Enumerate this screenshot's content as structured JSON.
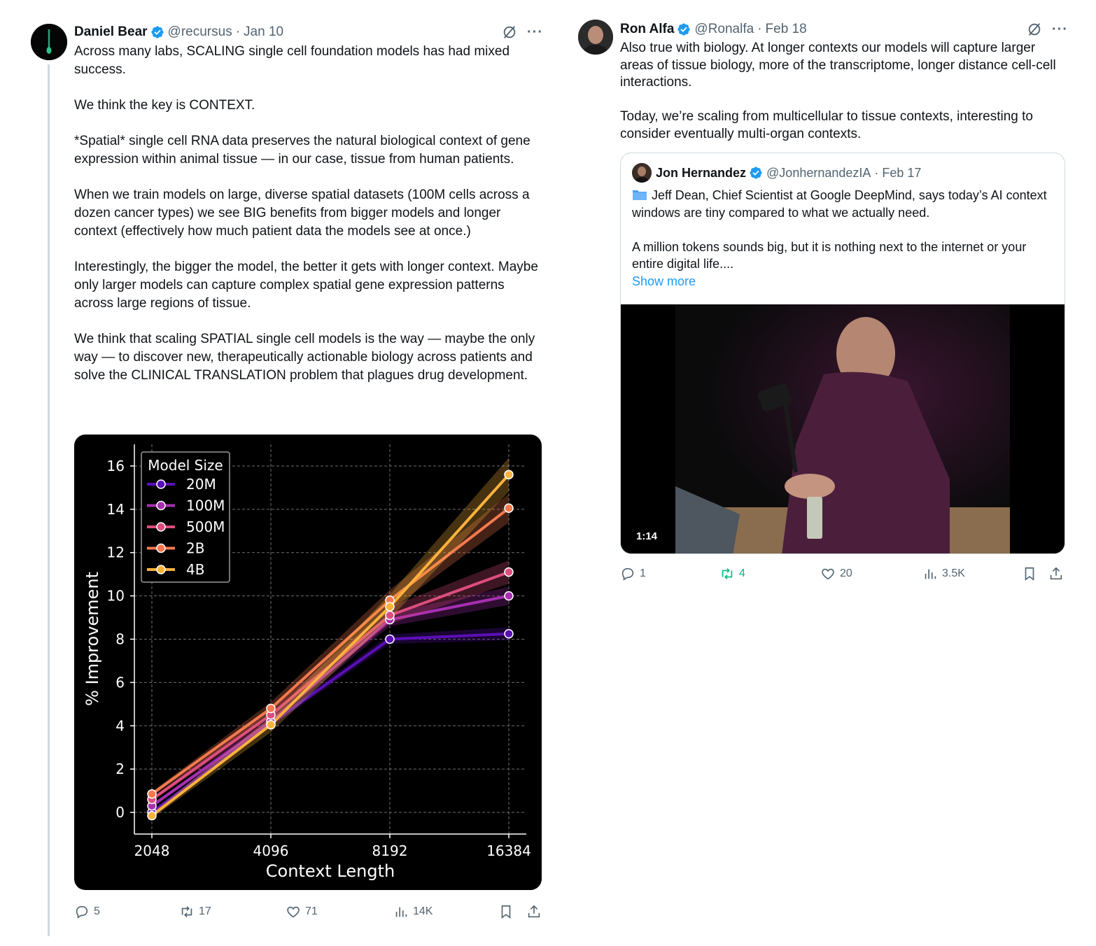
{
  "left_tweet": {
    "author_name": "Daniel Bear",
    "handle": "@recursus",
    "separator": "·",
    "date": "Jan 10",
    "paragraphs": [
      "Across many labs, SCALING single cell foundation models has had mixed success.",
      "We think the key is CONTEXT.",
      "*Spatial* single cell RNA data preserves the natural biological context of gene expression within animal tissue — in our case, tissue from human patients.",
      "When we train models on large, diverse spatial datasets (100M cells across a dozen cancer types) we see BIG benefits from bigger models and longer context (effectively how much patient data the models see at once.)",
      "Interestingly, the bigger the model, the better it gets with longer context. Maybe only larger models can capture complex spatial gene expression patterns across large regions of tissue.",
      "We think that scaling SPATIAL single cell models is the way — maybe the only way — to discover new, therapeutically actionable biology across patients and solve the CLINICAL TRANSLATION problem that plagues drug development."
    ],
    "actions": {
      "replies": "5",
      "retweets": "17",
      "likes": "71",
      "views": "14K"
    }
  },
  "chart_data": {
    "type": "line",
    "x": [
      "2048",
      "4096",
      "8192",
      "16384"
    ],
    "xlabel": "Context Length",
    "ylabel": "% Improvement",
    "ylim": [
      -1,
      17
    ],
    "yticks": [
      "0",
      "2",
      "4",
      "6",
      "8",
      "10",
      "12",
      "14",
      "16"
    ],
    "legend_title": "Model Size",
    "legend_position": "top-left",
    "grid": true,
    "series": [
      {
        "name": "20M",
        "color": "#5a0fb5",
        "values": [
          0.0,
          4.1,
          8.0,
          8.25
        ]
      },
      {
        "name": "100M",
        "color": "#a72fb0",
        "values": [
          0.3,
          4.2,
          8.9,
          10.0
        ]
      },
      {
        "name": "500M",
        "color": "#dd4d7d",
        "values": [
          0.6,
          4.5,
          9.1,
          11.1
        ]
      },
      {
        "name": "2B",
        "color": "#f47a4e",
        "values": [
          0.85,
          4.8,
          9.8,
          14.05
        ]
      },
      {
        "name": "4B",
        "color": "#fbb23c",
        "values": [
          -0.15,
          4.05,
          9.5,
          15.6
        ]
      }
    ]
  },
  "right_tweet": {
    "author_name": "Ron Alfa",
    "handle": "@Ronalfa",
    "separator": "·",
    "date": "Feb 18",
    "paragraphs": [
      "Also true with biology. At longer contexts our models will capture larger areas of tissue biology, more of the transcriptome, longer distance cell-cell interactions.",
      "Today, we’re scaling from multicellular to tissue contexts, interesting to consider eventually multi-organ contexts."
    ],
    "quote": {
      "author_name": "Jon Hernandez",
      "handle": "@JonhernandezIA",
      "separator": "·",
      "date": "Feb 17",
      "line1": "Jeff Dean, Chief Scientist at Google DeepMind, says today’s AI context windows are tiny compared to what we actually need.",
      "line2": "A million tokens sounds big, but it is nothing next to the internet or your entire digital life....",
      "show_more": "Show more",
      "video_duration": "1:14"
    },
    "actions": {
      "replies": "1",
      "retweets": "4",
      "likes": "20",
      "views": "3.5K"
    }
  },
  "icons": [
    "grok-icon",
    "more-icon",
    "verified-icon",
    "reply-icon",
    "retweet-icon",
    "like-icon",
    "views-icon",
    "bookmark-icon",
    "share-icon",
    "folder-icon"
  ],
  "colors": {
    "verified": "#1d9bf0",
    "retweet_active": "#00ba7c",
    "muted": "#536471",
    "link": "#1d9bf0"
  }
}
